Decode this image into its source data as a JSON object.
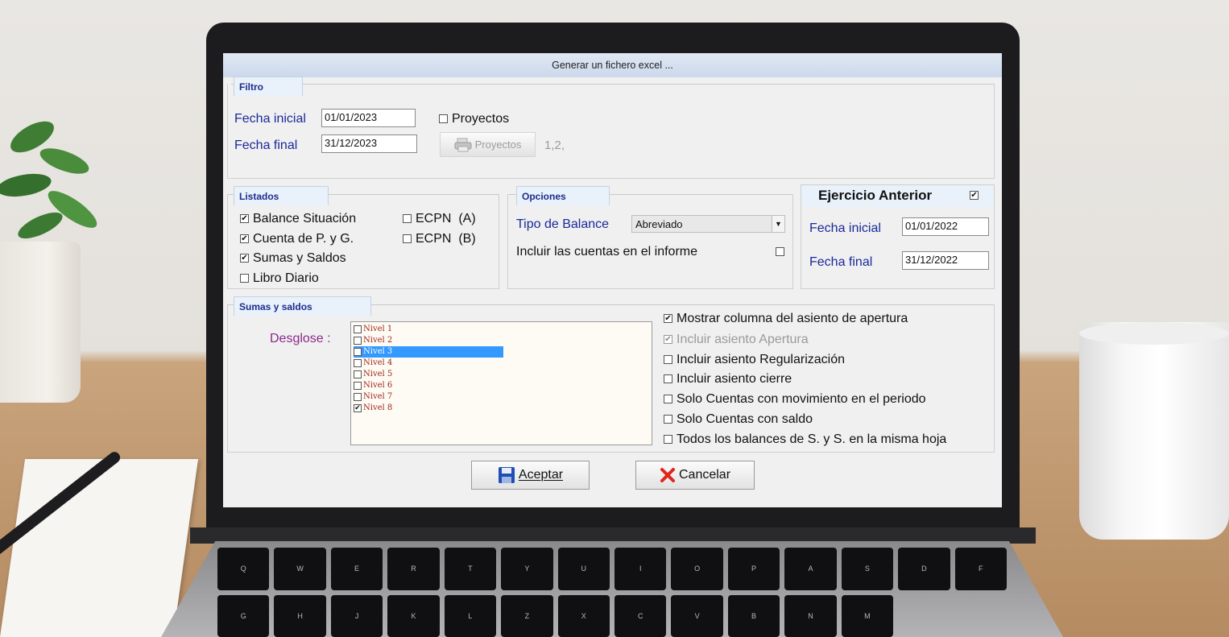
{
  "window": {
    "title": "Generar un fichero excel ..."
  },
  "filtro": {
    "tab": "Filtro",
    "fecha_inicial_label": "Fecha inicial",
    "fecha_inicial_value": "01/01/2023",
    "fecha_final_label": "Fecha final",
    "fecha_final_value": "31/12/2023",
    "proyectos_checkbox_label": "Proyectos",
    "proyectos_checked": false,
    "proyectos_button_label": "Proyectos",
    "proyectos_selection": "1,2,"
  },
  "listados": {
    "tab": "Listados",
    "items": [
      {
        "label": "Balance Situación",
        "checked": true
      },
      {
        "label": "Cuenta de P. y G.",
        "checked": true
      },
      {
        "label": "Sumas y Saldos",
        "checked": true
      },
      {
        "label": "Libro Diario",
        "checked": false
      },
      {
        "label": "ECPN  (A)",
        "checked": false
      },
      {
        "label": "ECPN  (B)",
        "checked": false
      }
    ]
  },
  "opciones": {
    "tab": "Opciones",
    "tipo_balance_label": "Tipo de Balance",
    "tipo_balance_value": "Abreviado",
    "incluir_cuentas_label": "Incluir las cuentas en el informe",
    "incluir_cuentas_checked": false
  },
  "ejercicio_anterior": {
    "title": "Ejercicio Anterior",
    "checked": true,
    "fecha_inicial_label": "Fecha inicial",
    "fecha_inicial_value": "01/01/2022",
    "fecha_final_label": "Fecha final",
    "fecha_final_value": "31/12/2022"
  },
  "sumas_saldos": {
    "tab": "Sumas y saldos",
    "desglose_label": "Desglose :",
    "niveles": [
      {
        "label": "Nivel 1",
        "checked": false,
        "selected": false
      },
      {
        "label": "Nivel 2",
        "checked": false,
        "selected": false
      },
      {
        "label": "Nivel 3",
        "checked": false,
        "selected": true
      },
      {
        "label": "Nivel 4",
        "checked": false,
        "selected": false
      },
      {
        "label": "Nivel 5",
        "checked": false,
        "selected": false
      },
      {
        "label": "Nivel 6",
        "checked": false,
        "selected": false
      },
      {
        "label": "Nivel 7",
        "checked": false,
        "selected": false
      },
      {
        "label": "Nivel 8",
        "checked": true,
        "selected": false
      }
    ],
    "options": [
      {
        "label": "Mostrar columna del asiento de apertura",
        "checked": true,
        "disabled": false
      },
      {
        "label": "Incluir asiento Apertura",
        "checked": true,
        "disabled": true
      },
      {
        "label": "Incluir asiento Regularización",
        "checked": false,
        "disabled": false
      },
      {
        "label": "Incluir asiento cierre",
        "checked": false,
        "disabled": false
      },
      {
        "label": "Solo Cuentas con movimiento en el periodo",
        "checked": false,
        "disabled": false
      },
      {
        "label": "Solo Cuentas con saldo",
        "checked": false,
        "disabled": false
      },
      {
        "label": "Todos los balances de S. y S. en la misma hoja",
        "checked": false,
        "disabled": false
      }
    ]
  },
  "buttons": {
    "aceptar": "Aceptar",
    "cancelar": "Cancelar"
  },
  "icons": {
    "aceptar": "floppy-disk-icon",
    "cancelar": "red-x-icon",
    "proyectos": "printer-icon"
  },
  "keyboard_keys": [
    "Q",
    "W",
    "E",
    "R",
    "T",
    "Y",
    "U",
    "I",
    "O",
    "P",
    "A",
    "S",
    "D",
    "F",
    "G",
    "H",
    "J",
    "K",
    "L",
    "Z",
    "X",
    "C",
    "V",
    "B",
    "N",
    "M"
  ]
}
